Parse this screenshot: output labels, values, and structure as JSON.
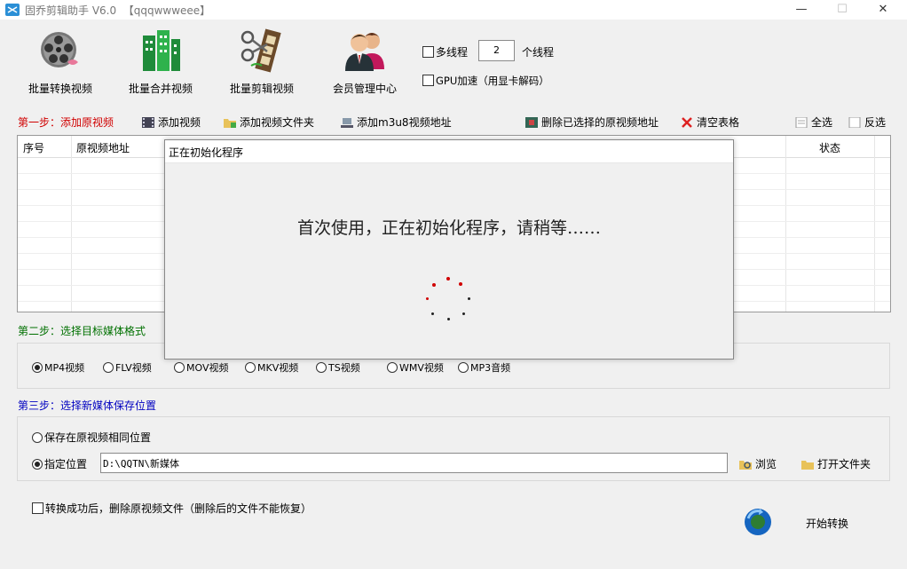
{
  "window": {
    "title": "固乔剪辑助手 V6.0  【qqqwwweee】",
    "controls": {
      "minimize": "—",
      "maximize": "☐",
      "close": "✕"
    }
  },
  "toolbar": {
    "items": [
      {
        "label": "批量转换视频",
        "icon": "film-reel-icon"
      },
      {
        "label": "批量合并视频",
        "icon": "merge-grid-icon"
      },
      {
        "label": "批量剪辑视频",
        "icon": "scissors-film-icon"
      },
      {
        "label": "会员管理中心",
        "icon": "members-icon"
      }
    ],
    "multithread_label": "多线程",
    "thread_count": "2",
    "thread_suffix": "个线程",
    "gpu_label": "GPU加速（用显卡解码）"
  },
  "step1": {
    "label": "第一步：添加原视频",
    "add_video": "添加视频",
    "add_folder": "添加视频文件夹",
    "add_m3u8": "添加m3u8视频地址",
    "delete_selected": "删除已选择的原视频地址",
    "clear_table": "清空表格",
    "select_all": "全选",
    "invert": "反选"
  },
  "table": {
    "columns": [
      "序号",
      "原视频地址",
      "状态"
    ]
  },
  "step2": {
    "label": "第二步：选择目标媒体格式",
    "formats": [
      "MP4视频",
      "FLV视频",
      "MOV视频",
      "MKV视频",
      "TS视频",
      "WMV视频",
      "MP3音频"
    ],
    "selected": "MP4视频"
  },
  "step3": {
    "label": "第三步：选择新媒体保存位置",
    "same_location": "保存在原视频相同位置",
    "specified": "指定位置",
    "path": "D:\\QQTN\\新媒体",
    "browse": "浏览",
    "open_folder": "打开文件夹"
  },
  "footer": {
    "delete_after": "转换成功后，删除原视频文件（删除后的文件不能恢复）",
    "start": "开始转换"
  },
  "dialog": {
    "title": "正在初始化程序",
    "message": "首次使用，正在初始化程序，请稍等……"
  },
  "colors": {
    "step1": "#d00000",
    "step2": "#007000",
    "step3": "#0000c0",
    "spinner": "#d00000"
  }
}
